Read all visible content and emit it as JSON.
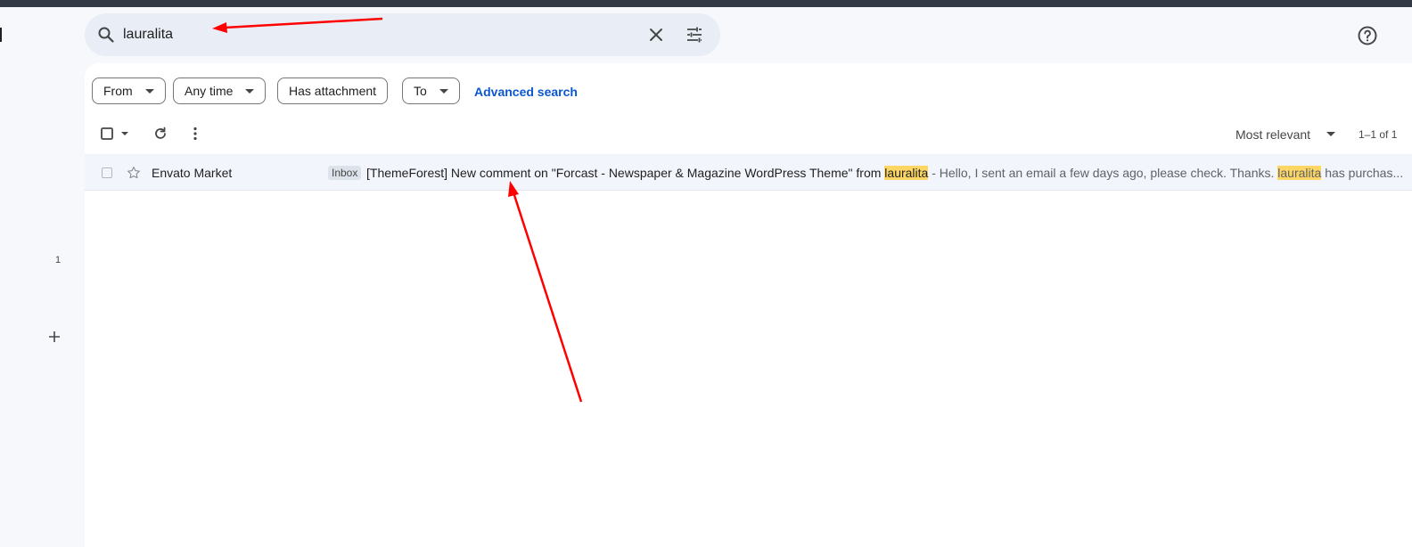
{
  "search": {
    "query": "lauralita"
  },
  "rail": {
    "count": "1"
  },
  "filters": {
    "chips": [
      {
        "label": "From"
      },
      {
        "label": "Any time"
      },
      {
        "label": "Has attachment"
      },
      {
        "label": "To"
      }
    ],
    "advanced_search_label": "Advanced search"
  },
  "toolbar": {
    "sort_label": "Most relevant",
    "pager": "1–1 of 1"
  },
  "results": [
    {
      "sender": "Envato Market",
      "label": "Inbox",
      "subject_pre": "[ThemeForest] New comment on \"Forcast - Newspaper & Magazine WordPress Theme\" from ",
      "subject_highlight": "lauralita",
      "snippet_pre": " - Hello, I sent an email a few days ago, please check. Thanks. ",
      "snippet_highlight": "lauralita",
      "snippet_post": " has purchas..."
    }
  ],
  "colors": {
    "accent": "#0b57d0",
    "highlight": "#fdd663",
    "annotation_arrow": "#ff0000"
  },
  "icons": [
    "search-icon",
    "clear-icon",
    "search-options-icon",
    "help-icon",
    "checkbox-icon",
    "refresh-icon",
    "more-vert-icon",
    "star-icon",
    "plus-icon"
  ]
}
